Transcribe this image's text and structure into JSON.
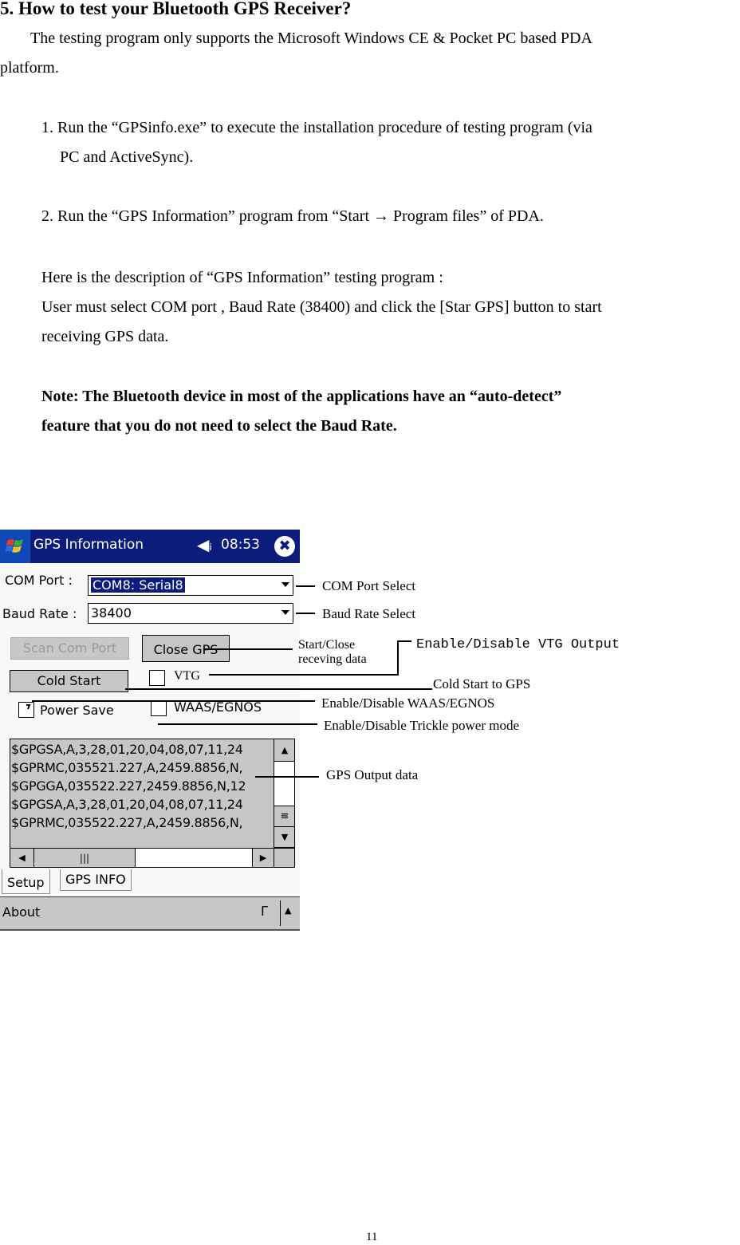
{
  "document": {
    "heading": "5. How to test your Bluetooth GPS Receiver?",
    "intro_line1": "The testing program only supports the Microsoft Windows CE & Pocket PC based PDA",
    "intro_line2": "platform.",
    "step1_line1": "1. Run the “GPSinfo.exe” to execute the installation procedure of testing program (via",
    "step1_line2": "PC and ActiveSync).",
    "step2": "2. Run the “GPS Information” program from “Start  →  Program files” of PDA.",
    "desc_line1": "Here is the description of “GPS Information” testing program :",
    "desc_line2": "User must select COM port , Baud Rate (38400) and click the [Star GPS] button to start",
    "desc_line3": "receiving GPS data.",
    "note_line1": "Note: The Bluetooth device in most of the applications have an “auto-detect”",
    "note_line2": "feature that you do not need to select the Baud Rate.",
    "page_number": "11"
  },
  "pda": {
    "title": "GPS Information",
    "speaker_icon": "🔈",
    "clock": "08:53",
    "close_glyph": "✖",
    "com_port_label": "COM Port :",
    "com_port_value": "COM8:  Serial8",
    "baud_rate_label": "Baud Rate :",
    "baud_rate_value": "38400",
    "scan_button": "Scan Com Port",
    "close_gps_button": "Close GPS",
    "cold_start_button": "Cold Start",
    "vtg_label": "VTG",
    "power_save_label": "Power Save",
    "waas_label": "WAAS/EGNOS",
    "power_save_checked": true,
    "vtg_checked": false,
    "waas_checked": false,
    "log_lines": [
      "$GPGSA,A,3,28,01,20,04,08,07,11,24",
      "$GPRMC,035521.227,A,2459.8856,N,",
      "$GPGGA,035522.227,2459.8856,N,12",
      "$GPGSA,A,3,28,01,20,04,08,07,11,24",
      "$GPRMC,035522.227,A,2459.8856,N,"
    ],
    "tabs": [
      "Setup",
      "GPS INFO"
    ],
    "active_tab": "Setup",
    "menu_about": "About"
  },
  "annotations": {
    "com_port_select": "COM Port Select",
    "baud_rate_select": "Baud Rate Select",
    "start_close_line1": "Start/Close",
    "start_close_line2": "receving data",
    "vtg_output": "Enable/Disable  VTG  Output",
    "cold_start": "Cold Start to GPS",
    "waas": "Enable/Disable  WAAS/EGNOS",
    "trickle": "Enable/Disable  Trickle power mode",
    "gps_output": "GPS Output data"
  }
}
